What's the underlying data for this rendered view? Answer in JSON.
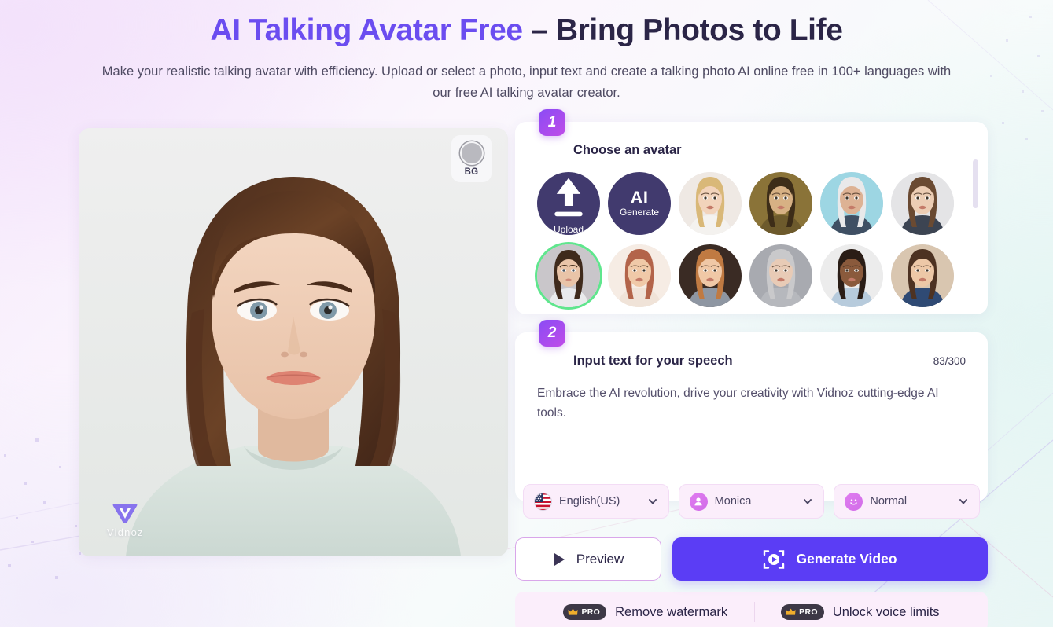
{
  "hero": {
    "title_accent": "AI Talking Avatar Free",
    "title_rest": " – Bring Photos to Life",
    "subtitle": "Make your realistic talking avatar with efficiency. Upload or select a photo, input text and create a talking photo AI online free in 100+ languages with our free AI talking avatar creator."
  },
  "preview": {
    "bg_button_label": "BG",
    "watermark_text": "Vidnoz"
  },
  "step1": {
    "number": "1",
    "title": "Choose an avatar",
    "avatars": [
      {
        "name": "upload",
        "label": "Upload",
        "big": "",
        "icon": "upload-icon",
        "selected": false
      },
      {
        "name": "ai-generate",
        "label": "Generate",
        "big": "AI",
        "icon": "",
        "selected": false
      },
      {
        "name": "avatar-blonde-woman",
        "label": "",
        "big": "",
        "icon": "",
        "selected": false
      },
      {
        "name": "avatar-mona-lisa",
        "label": "",
        "big": "",
        "icon": "",
        "selected": false
      },
      {
        "name": "avatar-einstein",
        "label": "",
        "big": "",
        "icon": "",
        "selected": false
      },
      {
        "name": "avatar-man-glasses",
        "label": "",
        "big": "",
        "icon": "",
        "selected": false
      },
      {
        "name": "avatar-brunette-woman",
        "label": "",
        "big": "",
        "icon": "",
        "selected": true
      },
      {
        "name": "avatar-cartoon-man",
        "label": "",
        "big": "",
        "icon": "",
        "selected": false
      },
      {
        "name": "avatar-cartoon-woman",
        "label": "",
        "big": "",
        "icon": "",
        "selected": false
      },
      {
        "name": "avatar-senior-woman",
        "label": "",
        "big": "",
        "icon": "",
        "selected": false
      },
      {
        "name": "avatar-black-man",
        "label": "",
        "big": "",
        "icon": "",
        "selected": false
      },
      {
        "name": "avatar-business-woman",
        "label": "",
        "big": "",
        "icon": "",
        "selected": false
      }
    ]
  },
  "step2": {
    "number": "2",
    "title": "Input text for your speech",
    "counter": "83/300",
    "speech_text": "Embrace the AI revolution, drive your creativity with Vidnoz cutting-edge AI tools.",
    "speech_placeholder": "Input text for your speech",
    "selects": [
      {
        "name": "language-select",
        "icon": "us-flag-icon",
        "value": "English(US)"
      },
      {
        "name": "voice-select",
        "icon": "person-icon",
        "value": "Monica"
      },
      {
        "name": "style-select",
        "icon": "smiley-icon",
        "value": "Normal"
      }
    ]
  },
  "actions": {
    "preview_label": "Preview",
    "generate_label": "Generate Video"
  },
  "promos": [
    {
      "name": "remove-watermark-promo",
      "badge": "PRO",
      "label": "Remove watermark"
    },
    {
      "name": "unlock-voice-limits-promo",
      "badge": "PRO",
      "label": "Unlock voice limits"
    }
  ],
  "colors": {
    "accent_purple": "#6b4df0",
    "generate_button": "#5b3df5",
    "selected_ring": "#5fe68d",
    "step_badge_from": "#8a4cf5",
    "step_badge_to": "#c04ce8",
    "pro_pill": "#3d3846",
    "crown_gold": "#f0ae2c"
  }
}
